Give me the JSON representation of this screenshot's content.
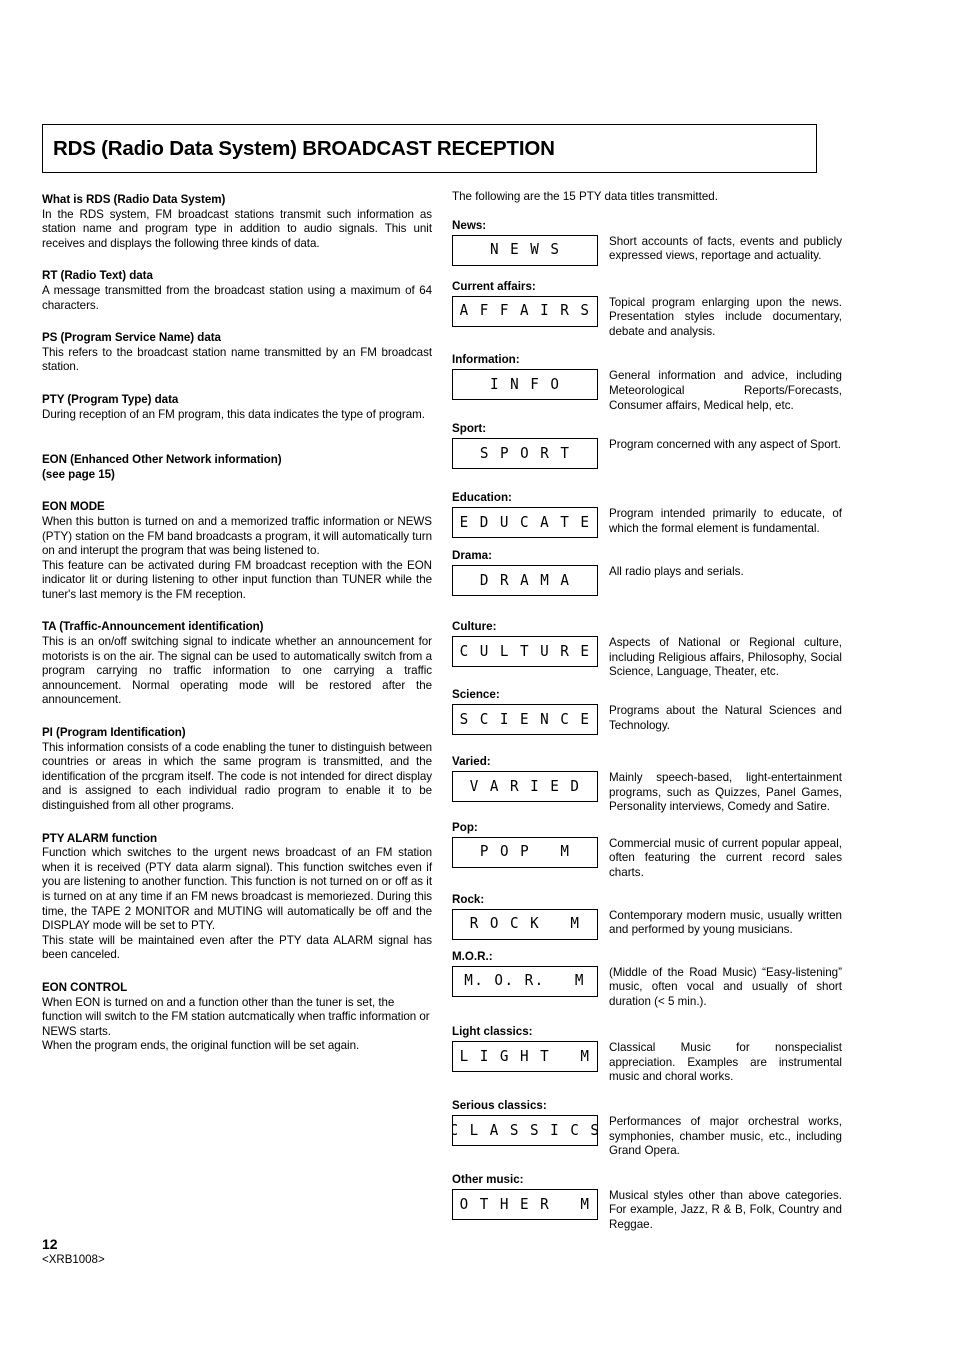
{
  "header": {
    "title": "RDS (Radio Data System) BROADCAST RECEPTION"
  },
  "left_column": {
    "sections": [
      {
        "heading": "What is RDS (Radio Data System)",
        "paragraphs": [
          "In the RDS system, FM broadcast stations transmit such information as station name and program type in addition to audio signals. This unit receives and displays the following three kinds of data."
        ]
      },
      {
        "heading": "RT (Radio Text) data",
        "paragraphs": [
          "A message transmitted from the broadcast station using a maximum of 64 characters."
        ]
      },
      {
        "heading": "PS (Program Service Name) data",
        "paragraphs": [
          "This refers to the broadcast station name transmitted by an FM broadcast station."
        ]
      },
      {
        "heading": "PTY (Program Type) data",
        "paragraphs": [
          "During reception of an FM program, this data indicates the type of program."
        ]
      },
      {
        "heading": "EON (Enhanced Other Network information)\n(see page 15)",
        "paragraphs": []
      },
      {
        "heading": "EON MODE",
        "paragraphs": [
          "When this button is turned on and a memorized traffic information or NEWS (PTY) station on the FM band broadcasts a program, it will automatically turn on and interupt the program that was being listened to.",
          "This feature can be activated during FM broadcast reception with the EON indicator lit or during listening to other input function than TUNER while the tuner's last memory is the FM reception."
        ]
      },
      {
        "heading": "TA (Traffic-Announcement identification)",
        "paragraphs": [
          "This is an on/off switching signal to indicate whether an announcement for motorists is on the air. The signal can be used to automatically switch from a program carrying no traffic information to one carrying a traffic announcement. Normal operating mode will be restored after the announcement."
        ]
      },
      {
        "heading": "PI (Program Identification)",
        "paragraphs": [
          "This information consists of a code enabling the tuner to distinguish between countries or areas in which the same program is transmitted, and the identification of the prcgram itself. The code is not intended for direct display and is assigned to each individual radio program to enable it to be distinguished from all other programs."
        ]
      },
      {
        "heading": "PTY ALARM function",
        "paragraphs": [
          "Function which switches to the urgent news broadcast of an FM station when it is received (PTY data alarm signal). This function switches even if you are listening to another function. This function is not turned on or off as it is turned on at any time if an FM news broadcast is memoriezed. During this time, the TAPE 2 MONITOR and MUTING will automatically be off and the DISPLAY mode will be set to PTY.",
          "This state will be maintained even after the PTY data ALARM signal has been canceled."
        ]
      },
      {
        "heading": "EON CONTROL",
        "paragraphs": [
          "When EON is turned on and a function other than the tuner is set, the function will switch to the FM station autcmatically when traffic information or NEWS starts.",
          "When the program ends, the original function will be set again."
        ]
      }
    ]
  },
  "right_column": {
    "intro": "The following are the 15 PTY data titles transmitted.",
    "pty_entries": [
      {
        "label": "News:",
        "display": "N E W S",
        "description": "Short accounts of facts, events and publicly expressed views, reportage and actuality."
      },
      {
        "label": "Current affairs:",
        "display": "A F F A I R S",
        "description": "Topical program enlarging upon the news. Presentation styles include documentary, debate and analysis."
      },
      {
        "label": "Information:",
        "display": "I N F O",
        "description": "General information and advice, including Meteorological Reports/Forecasts, Consumer affairs, Medical help, etc."
      },
      {
        "label": "Sport:",
        "display": "S P O R T",
        "description": "Program concerned with any aspect of Sport."
      },
      {
        "label": "Education:",
        "display": "E D U C A T E",
        "description": "Program intended primarily to educate, of which the formal element is fundamental."
      },
      {
        "label": "Drama:",
        "display": "D R A M A",
        "description": "All radio plays and serials."
      },
      {
        "label": "Culture:",
        "display": "C U L T U R E",
        "description": "Aspects of National or Regional culture, including Religious affairs, Philosophy, Social Science, Language, Theater, etc."
      },
      {
        "label": "Science:",
        "display": "S C I E N C E",
        "description": "Programs about the Natural Sciences and Technology."
      },
      {
        "label": "Varied:",
        "display": "V A R I E D",
        "description": "Mainly speech-based, light-entertainment programs, such as Quizzes, Panel Games, Personality interviews, Comedy and Satire."
      },
      {
        "label": "Pop:",
        "display": "P O P   M",
        "description": "Commercial music of current popular appeal, often featuring the current record sales charts."
      },
      {
        "label": "Rock:",
        "display": "R O C K   M",
        "description": "Contemporary modern music, usually written and performed by young musicians."
      },
      {
        "label": "M.O.R.:",
        "display": "M. O. R.   M",
        "description": "(Middle of the Road Music) “Easy-listening” music, often vocal and usually of short duration (< 5 min.)."
      },
      {
        "label": "Light classics:",
        "display": "L I G H T   M",
        "description": "Classical Music for nonspecialist appreciation. Examples are instrumental music and choral works."
      },
      {
        "label": "Serious classics:",
        "display": "C L A S S I C S",
        "description": "Performances of major orchestral works, symphonies, chamber music, etc., including Grand Opera."
      },
      {
        "label": "Other music:",
        "display": "O T H E R   M",
        "description": "Musical styles other than above categories. For example, Jazz, R & B, Folk, Country and Reggae."
      }
    ]
  },
  "footer": {
    "page_number": "12",
    "code": "<XRB1008>"
  }
}
